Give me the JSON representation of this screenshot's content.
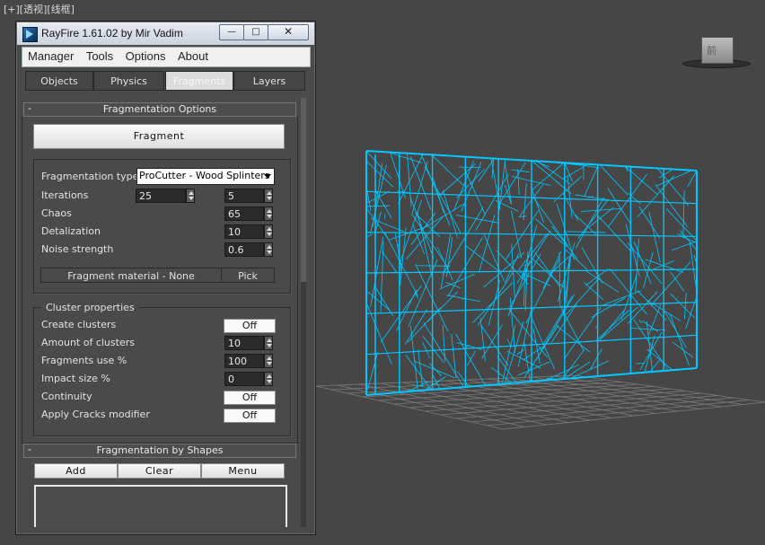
{
  "viewport": {
    "label": "[+][透视][线框]",
    "accent_color": "#00c8ff",
    "grid_color": "#7a7a7a"
  },
  "viewcube": {
    "icon": "viewcube-icon",
    "label": "前"
  },
  "window": {
    "title": "RayFire 1.61.02  by Mir Vadim",
    "buttons": {
      "minimize": "—",
      "maximize": "□",
      "close": "✕"
    }
  },
  "menu": [
    "Manager",
    "Tools",
    "Options",
    "About"
  ],
  "tabs": [
    "Objects",
    "Physics",
    "Fragments",
    "Layers"
  ],
  "fragmentation_options": {
    "header": "Fragmentation Options",
    "collapse": "-",
    "fragment_button": "Fragment",
    "type_label": "Fragmentation type",
    "type_value": "ProCutter - Wood Splinters",
    "iterations_label": "Iterations",
    "iterations_value_1": "25",
    "iterations_value_2": "5",
    "chaos_label": "Chaos",
    "chaos_value": "65",
    "detalization_label": "Detalization",
    "detalization_value": "10",
    "noise_label": "Noise strength",
    "noise_value": "0.6",
    "material_label": "Fragment material - None",
    "pick_label": "Pick"
  },
  "cluster": {
    "title": "Cluster properties",
    "create_label": "Create clusters",
    "create_value": "Off",
    "amount_label": "Amount of clusters",
    "amount_value": "10",
    "use_label": "Fragments use %",
    "use_value": "100",
    "impact_label": "Impact size %",
    "impact_value": "0",
    "continuity_label": "Continuity",
    "continuity_value": "Off",
    "cracks_label": "Apply Cracks modifier",
    "cracks_value": "Off"
  },
  "shapes": {
    "header": "Fragmentation by Shapes",
    "collapse": "-",
    "add": "Add",
    "clear": "Clear",
    "menu": "Menu"
  }
}
